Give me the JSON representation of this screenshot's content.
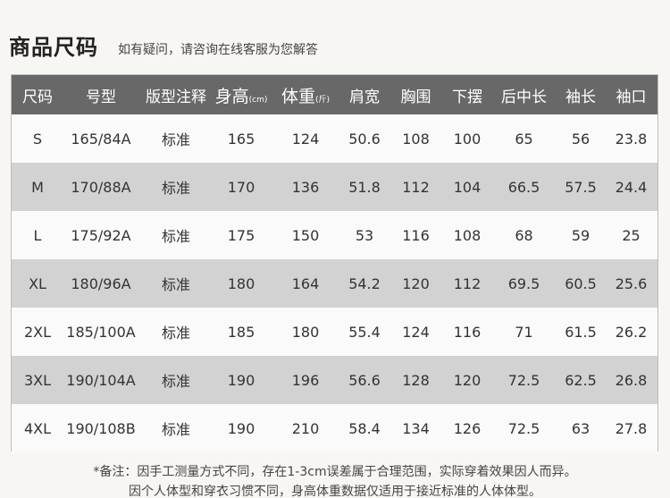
{
  "heading": {
    "title": "商品尺码",
    "subtitle": "如有疑问，请咨询在线客服为您解答"
  },
  "table": {
    "headers": [
      {
        "text": "尺码"
      },
      {
        "text": "号型"
      },
      {
        "text": "版型注释"
      },
      {
        "text": "身高",
        "unit": "(cm)"
      },
      {
        "text": "体重",
        "unit": "(斤)"
      },
      {
        "text": "肩宽"
      },
      {
        "text": "胸围"
      },
      {
        "text": "下摆"
      },
      {
        "text": "后中长"
      },
      {
        "text": "袖长"
      },
      {
        "text": "袖口"
      }
    ],
    "rows": [
      [
        "S",
        "165/84A",
        "标准",
        "165",
        "124",
        "50.6",
        "108",
        "100",
        "65",
        "56",
        "23.8"
      ],
      [
        "M",
        "170/88A",
        "标准",
        "170",
        "136",
        "51.8",
        "112",
        "104",
        "66.5",
        "57.5",
        "24.4"
      ],
      [
        "L",
        "175/92A",
        "标准",
        "175",
        "150",
        "53",
        "116",
        "108",
        "68",
        "59",
        "25"
      ],
      [
        "XL",
        "180/96A",
        "标准",
        "180",
        "164",
        "54.2",
        "120",
        "112",
        "69.5",
        "60.5",
        "25.6"
      ],
      [
        "2XL",
        "185/100A",
        "标准",
        "185",
        "180",
        "55.4",
        "124",
        "116",
        "71",
        "61.5",
        "26.2"
      ],
      [
        "3XL",
        "190/104A",
        "标准",
        "190",
        "196",
        "56.6",
        "128",
        "120",
        "72.5",
        "62.5",
        "26.8"
      ],
      [
        "4XL",
        "190/108B",
        "标准",
        "190",
        "210",
        "58.4",
        "134",
        "126",
        "72.5",
        "63",
        "27.8"
      ]
    ]
  },
  "notes": {
    "line1": "*备注：因手工测量方式不同，存在1-3cm误差属于合理范围，实际穿着效果因人而异。",
    "line2": "因个人体型和穿衣习惯不同，身高体重数据仅适用于接近标准的人体体型。"
  },
  "colors": {
    "header_bg": "#686868",
    "stripe_bg": "#d2d2d2",
    "page_bg": "#f8f6f2"
  }
}
